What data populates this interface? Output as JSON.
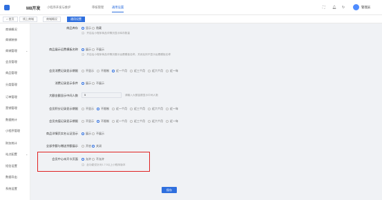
{
  "header": {
    "brand": "M8开发",
    "nav": [
      "小程序开发与维护",
      "审核管理",
      "通用设置"
    ],
    "active_nav_index": 2,
    "username": "管理员"
  },
  "tabs": [
    "首页",
    "线上商城",
    "商城概况",
    "通用设置"
  ],
  "active_tab_index": 3,
  "sidebar": {
    "items": [
      "商城概况",
      "商城装修",
      "商城管理",
      "会员管理",
      "商品管理",
      "分类管理",
      "订单管理",
      "营销管理",
      "数据统计",
      "小程序管理",
      "财务统计",
      "站点配置",
      "短信设置",
      "数据导出",
      "系统设置"
    ]
  },
  "settings": [
    {
      "label": "商品库存",
      "options": [
        "显示",
        "隐藏"
      ],
      "selected": 0,
      "hint": "注：开启后小程序商品详情页显示库存数量"
    },
    {
      "label": "商品展示运费模板名称",
      "options": [
        "展示",
        "不展示"
      ],
      "selected": 0,
      "hint": "注：开启后小程序商品详情页展示运费模板名称，关闭后则不显示运费模板名称"
    },
    {
      "label": "会员消费记录显示期限",
      "options": [
        "不显示",
        "不限制",
        "近一个月",
        "近三个月",
        "近六个月",
        "近一年"
      ],
      "selected": 2
    },
    {
      "label": "消费记录显示条件",
      "options": [
        "展示",
        "不展示"
      ],
      "selected": 0
    },
    {
      "label": "大额金额显示中间人数",
      "value": "5",
      "hint": "请输入大额金额显示中间人数"
    },
    {
      "label": "会员积分记录显示期限",
      "options": [
        "不显示",
        "不限制",
        "近一个月",
        "近三个月",
        "近六个月",
        "近一年"
      ],
      "selected": 1
    },
    {
      "label": "会员充值记录显示期限",
      "options": [
        "不显示",
        "不限制",
        "近一个月",
        "近三个月",
        "近六个月",
        "近一年"
      ],
      "selected": 1
    },
    {
      "label": "商品详情页实名认证显示",
      "options": [
        "展示",
        "不展示"
      ],
      "selected": 0
    },
    {
      "label": "全部余额与赠送余额展示",
      "options": [
        "开启",
        "关闭"
      ],
      "selected": 1
    },
    {
      "label": "会员中心未开卡页面",
      "options": [
        "允许",
        "不允许"
      ],
      "selected": 0,
      "hint": "注：此功能仅针对1.7.0以上小程序版本"
    }
  ],
  "actions": {
    "save_label": "保存"
  },
  "colors": {
    "primary": "#2f6fde",
    "highlight_border": "#e02020"
  }
}
